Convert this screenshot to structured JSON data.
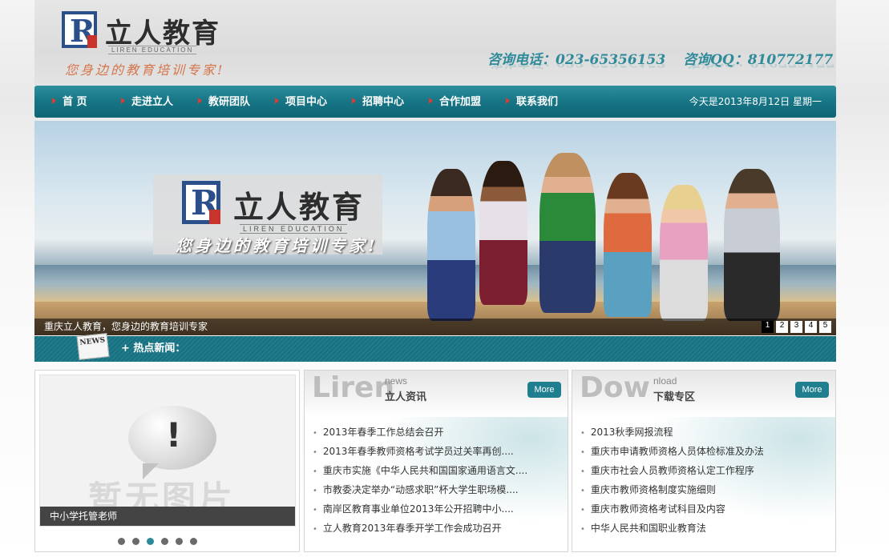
{
  "header": {
    "logo_text": "立人教育",
    "logo_en": "LIREN EDUCATION",
    "slogan": "您身边的教育培训专家!",
    "phone": "咨询电话：023-65356153",
    "qq": "咨询QQ：810772177"
  },
  "nav": {
    "items": [
      {
        "label": "首 页"
      },
      {
        "label": "走进立人"
      },
      {
        "label": "教研团队"
      },
      {
        "label": "项目中心"
      },
      {
        "label": "招聘中心"
      },
      {
        "label": "合作加盟"
      },
      {
        "label": "联系我们"
      }
    ],
    "date": "今天是2013年8月12日  星期一"
  },
  "banner": {
    "logo_text": "立人教育",
    "logo_en": "LIREN EDUCATION",
    "slogan": "您身边的教育培训专家!",
    "caption": "重庆立人教育，您身边的教育培训专家",
    "pages": [
      "1",
      "2",
      "3",
      "4",
      "5"
    ],
    "active_page": "1"
  },
  "news_bar": {
    "icon_text": "NEWS",
    "label": "+ 热点新闻："
  },
  "photo_box": {
    "placeholder_text": "暂无图片",
    "caption": "中小学托管老师",
    "dot_count": 6,
    "active_dot": 3
  },
  "news_box": {
    "big": "Liren",
    "small_en": "news",
    "title": "立人资讯",
    "more": "More",
    "items": [
      "2013年春季工作总结会召开",
      "2013年春季教师资格考试学员过关率再创....",
      "重庆市实施《中华人民共和国国家通用语言文....",
      "市教委决定举办“动感求职”杯大学生职场模....",
      "南岸区教育事业单位2013年公开招聘中小....",
      "立人教育2013年春季开学工作会成功召开"
    ]
  },
  "download_box": {
    "big": "Dow",
    "small_en": "nload",
    "title": "下载专区",
    "more": "More",
    "items": [
      "2013秋季网报流程",
      "重庆市申请教师资格人员体检标准及办法",
      "重庆市社会人员教师资格认定工作程序",
      "重庆市教师资格制度实施细则",
      "重庆市教师资格考试科目及内容",
      "中华人民共和国职业教育法"
    ]
  },
  "colors": {
    "nav": "#167585",
    "accent": "#2a8a9a",
    "contact": "#2f8a9a",
    "slogan": "#d6744a",
    "arrow": "#e23a2b"
  }
}
